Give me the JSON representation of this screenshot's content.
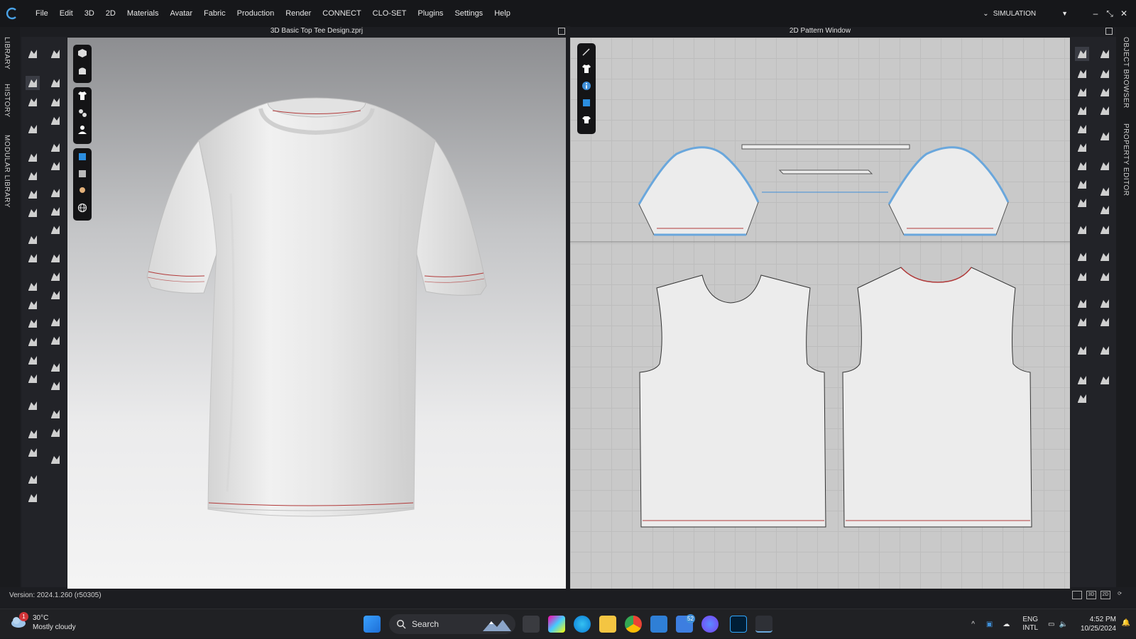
{
  "menubar": {
    "items": [
      "File",
      "Edit",
      "3D",
      "2D",
      "Materials",
      "Avatar",
      "Fabric",
      "Production",
      "Render",
      "CONNECT",
      "CLO-SET",
      "Plugins",
      "Settings",
      "Help"
    ],
    "mode_label": "SIMULATION"
  },
  "left_tabs": [
    "LIBRARY",
    "HISTORY",
    "MODULAR LIBRARY"
  ],
  "right_tabs": [
    "OBJECT BROWSER",
    "PROPERTY EDITOR"
  ],
  "viewport3d": {
    "title": "3D Basic Top Tee Design.zprj"
  },
  "viewport2d": {
    "title": "2D Pattern Window"
  },
  "status": {
    "version": "Version: 2024.1.260 (r50305)",
    "view_buttons": [
      "",
      "3D",
      "2D",
      ""
    ]
  },
  "taskbar": {
    "weather_temp": "30°C",
    "weather_desc": "Mostly cloudy",
    "weather_badge": "1",
    "search_placeholder": "Search",
    "teams_badge": "52",
    "lang_line1": "ENG",
    "lang_line2": "INTL",
    "time": "4:52 PM",
    "date": "10/25/2024"
  },
  "colors": {
    "accent": "#3f8fd8",
    "seam_red": "#b23a3a",
    "pattern_fill": "#ececec"
  }
}
